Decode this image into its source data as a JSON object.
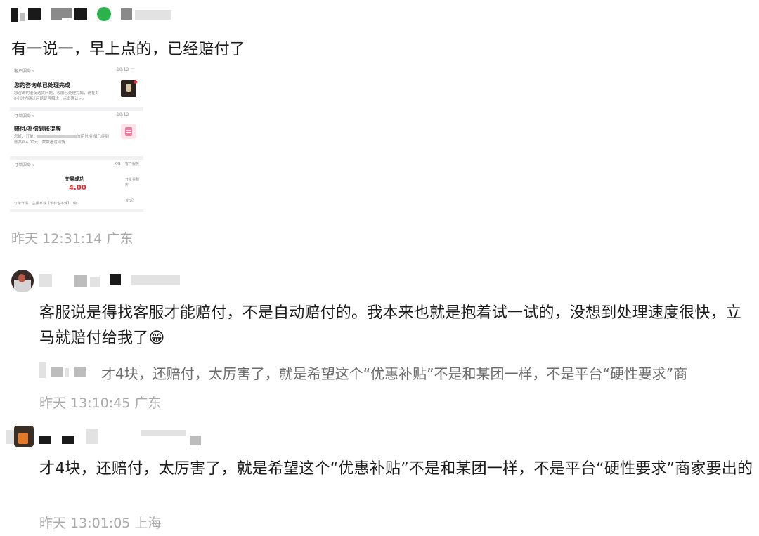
{
  "post": {
    "text": "有一说一，早上点的，已经赔付了",
    "meta": "昨天 12:31:14 广东"
  },
  "embedded_screenshot": {
    "card1": {
      "header": "客户服务 ›",
      "time": "10:12",
      "dots": "···",
      "title": "您的咨询单已处理完成",
      "body_line1": "您咨询的催促送货问题，客服已处理完成，请在4",
      "body_line2": "8小时内确认问题是否解决，点击确认>>"
    },
    "card2": {
      "header": "订单服务 ›",
      "time": "10:12",
      "title": "赔付/补偿到账提醒",
      "body_line1": "您好，订单：",
      "body_line1_tail": "的赔付/补偿已经到",
      "body_line2": "账共到4.00元，数数看这详情"
    },
    "card3": {
      "header": "订单服务 ›",
      "time": "08",
      "status": "交易成功",
      "amount": "4.00",
      "footer_a": "订单详情",
      "footer_b": "生椰拿铁【单杯也不辣】 1杯",
      "side1": "客户服务",
      "side2": "开发票服务",
      "side3": "收起"
    }
  },
  "reply1": {
    "text": "客服说是得找客服才能赔付，不是自动赔付的。我本来也就是抱着试一试的，没想到处理速度很快，立马就赔付给我了",
    "emoji": "😁",
    "quote": "才4块，还赔付，太厉害了，就是希望这个“优惠补贴”不是和某团一样，不是平台“硬性要求”商",
    "meta": "昨天 13:10:45 广东"
  },
  "reply2": {
    "text": "才4块，还赔付，太厉害了，就是希望这个“优惠补贴”不是和某团一样，不是平台“硬性要求”商家要出的",
    "meta": "昨天 13:01:05 上海"
  },
  "colors": {
    "meta_gray": "#a9a9a9",
    "price_red": "#e5242b",
    "wechat_green": "#2bb24c"
  }
}
